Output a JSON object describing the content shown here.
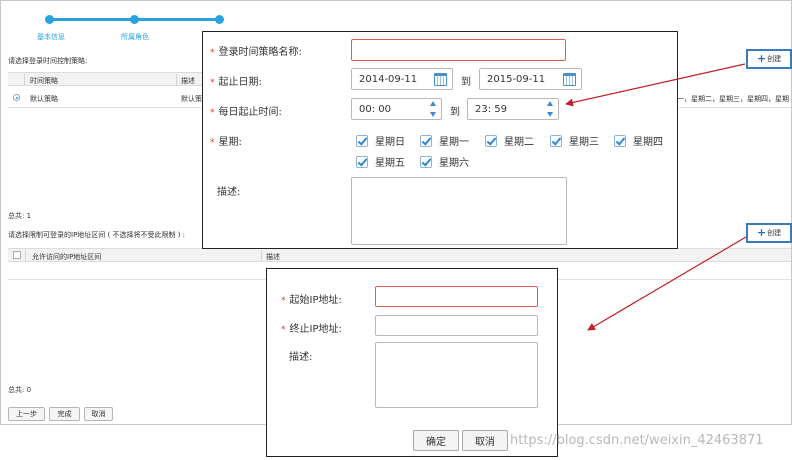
{
  "steps": [
    {
      "label": "基本信息"
    },
    {
      "label": "所属角色"
    },
    {
      "label": ""
    }
  ],
  "background": {
    "time_policy_prompt": "请选择登录时间控制策略:",
    "time_table": {
      "headers": [
        "时间策略",
        "描述"
      ],
      "rows": [
        {
          "name": "默认策略",
          "desc": "默认策"
        }
      ],
      "overflow_text": "一，星期二，星期三，星期四，星期"
    },
    "total_1": "总共: 1",
    "ip_prompt": "请选择限制可登录的IP地址区间 ( 不选择将不受此限制 ) :",
    "ip_table": {
      "headers": [
        "允许访问的IP地址区间",
        "描述"
      ]
    },
    "total_0": "总共: 0",
    "create_label": "创建",
    "buttons": {
      "prev": "上一步",
      "finish": "完成",
      "cancel": "取消"
    }
  },
  "time_dialog": {
    "name_label": "登录时间策略名称:",
    "name_value": "",
    "date_label": "起止日期:",
    "start_date": "2014-09-11",
    "to_label": "到",
    "end_date": "2015-09-11",
    "time_label": "每日起止时间:",
    "start_time": "00: 00",
    "end_time": "23: 59",
    "week_label": "星期:",
    "weekdays": [
      {
        "label": "星期日",
        "checked": true
      },
      {
        "label": "星期一",
        "checked": true
      },
      {
        "label": "星期二",
        "checked": true
      },
      {
        "label": "星期三",
        "checked": true
      },
      {
        "label": "星期四",
        "checked": true
      },
      {
        "label": "星期五",
        "checked": true
      },
      {
        "label": "星期六",
        "checked": true
      }
    ],
    "desc_label": "描述:"
  },
  "ip_dialog": {
    "start_label": "起始IP地址:",
    "end_label": "终止IP地址:",
    "desc_label": "描述:",
    "ok": "确定",
    "cancel": "取消"
  },
  "watermark": "https://blog.csdn.net/weixin_42463871",
  "colors": {
    "accent": "#29a3e0",
    "required": "#e0342d",
    "error_border": "#e45a55",
    "arrow": "#c0202a",
    "highlight_border": "#3a7ab8"
  }
}
